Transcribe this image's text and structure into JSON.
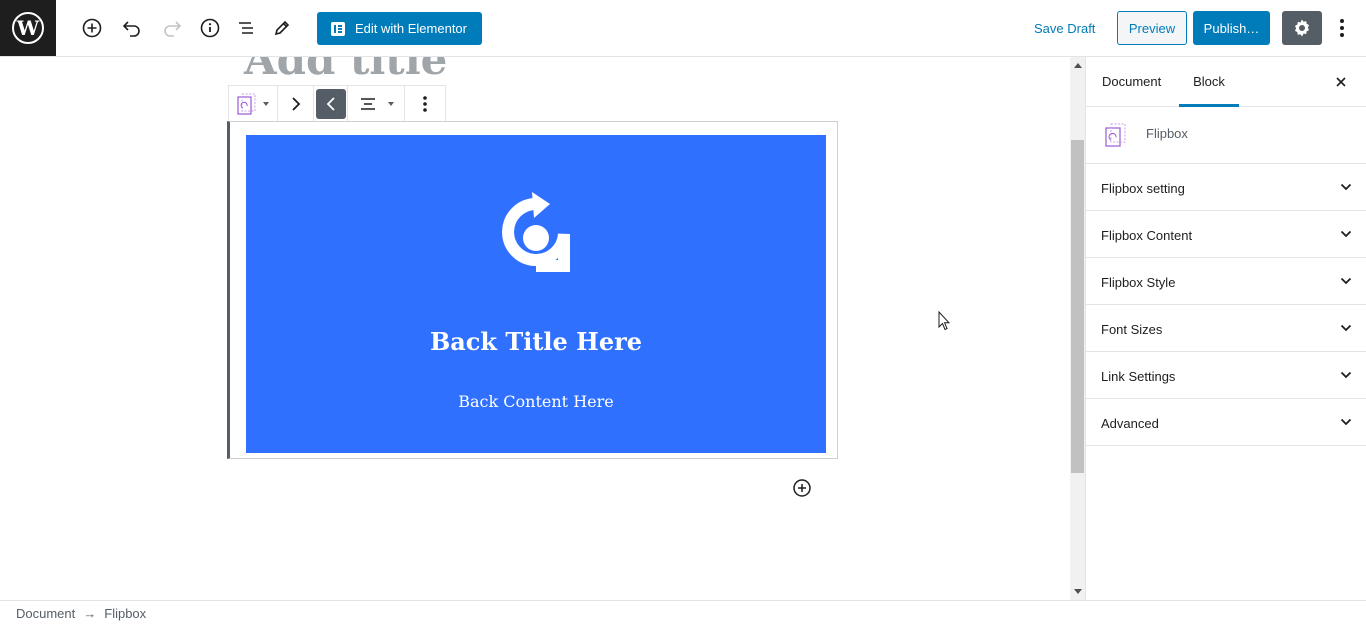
{
  "toolbar": {
    "edit_elementor_label": "Edit with Elementor",
    "save_draft_label": "Save Draft",
    "preview_label": "Preview",
    "publish_label": "Publish…"
  },
  "editor": {
    "title_placeholder": "Add title",
    "flipbox": {
      "back_title": "Back Title Here",
      "back_content": "Back Content Here",
      "background_color": "#2f70ff"
    }
  },
  "sidebar": {
    "tabs": [
      {
        "label": "Document",
        "active": false
      },
      {
        "label": "Block",
        "active": true
      }
    ],
    "block_name": "Flipbox",
    "panels": [
      {
        "label": "Flipbox setting"
      },
      {
        "label": "Flipbox Content"
      },
      {
        "label": "Flipbox Style"
      },
      {
        "label": "Font Sizes"
      },
      {
        "label": "Link Settings"
      },
      {
        "label": "Advanced"
      }
    ]
  },
  "breadcrumb": {
    "root": "Document",
    "separator": "→",
    "current": "Flipbox"
  },
  "colors": {
    "accent": "#007cba",
    "dark": "#1e1e1e",
    "settings_bg": "#555d66"
  }
}
